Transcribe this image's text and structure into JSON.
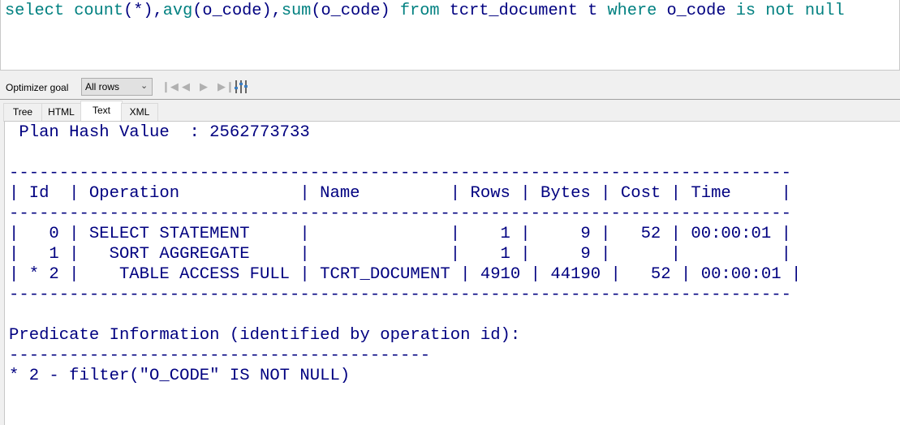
{
  "editor": {
    "tokens": [
      {
        "t": "select",
        "k": true
      },
      {
        "t": " ",
        "k": false
      },
      {
        "t": "count",
        "k": true
      },
      {
        "t": "(*),",
        "k": false
      },
      {
        "t": "avg",
        "k": true
      },
      {
        "t": "(o_code),",
        "k": false
      },
      {
        "t": "sum",
        "k": true
      },
      {
        "t": "(o_code) ",
        "k": false
      },
      {
        "t": "from",
        "k": true
      },
      {
        "t": " tcrt_document t ",
        "k": false
      },
      {
        "t": "where",
        "k": true
      },
      {
        "t": " o_code ",
        "k": false
      },
      {
        "t": "is",
        "k": true
      },
      {
        "t": " ",
        "k": false
      },
      {
        "t": "not",
        "k": true
      },
      {
        "t": " ",
        "k": false
      },
      {
        "t": "null",
        "k": true
      }
    ]
  },
  "toolbar": {
    "optimizer_goal_label": "Optimizer goal",
    "optimizer_goal_value": "All rows",
    "icons": [
      "first-icon",
      "previous-icon",
      "next-icon",
      "last-icon",
      "columns-settings-icon"
    ]
  },
  "tabs": [
    {
      "label": "Tree",
      "active": false
    },
    {
      "label": "HTML",
      "active": false
    },
    {
      "label": "Text",
      "active": true
    },
    {
      "label": "XML",
      "active": false
    }
  ],
  "plan": {
    "lines": [
      " Plan Hash Value  : 2562773733",
      "",
      "------------------------------------------------------------------------------",
      "| Id  | Operation            | Name         | Rows | Bytes | Cost | Time     |",
      "------------------------------------------------------------------------------",
      "|   0 | SELECT STATEMENT     |              |    1 |     9 |   52 | 00:00:01 |",
      "|   1 |   SORT AGGREGATE     |              |    1 |     9 |      |          |",
      "| * 2 |    TABLE ACCESS FULL | TCRT_DOCUMENT | 4910 | 44190 |   52 | 00:00:01 |",
      "------------------------------------------------------------------------------",
      "",
      "Predicate Information (identified by operation id):",
      "------------------------------------------",
      "* 2 - filter(\"O_CODE\" IS NOT NULL)"
    ]
  },
  "colors": {
    "keyword": "#008080",
    "identifier": "#000080",
    "plan_text": "#000080"
  }
}
